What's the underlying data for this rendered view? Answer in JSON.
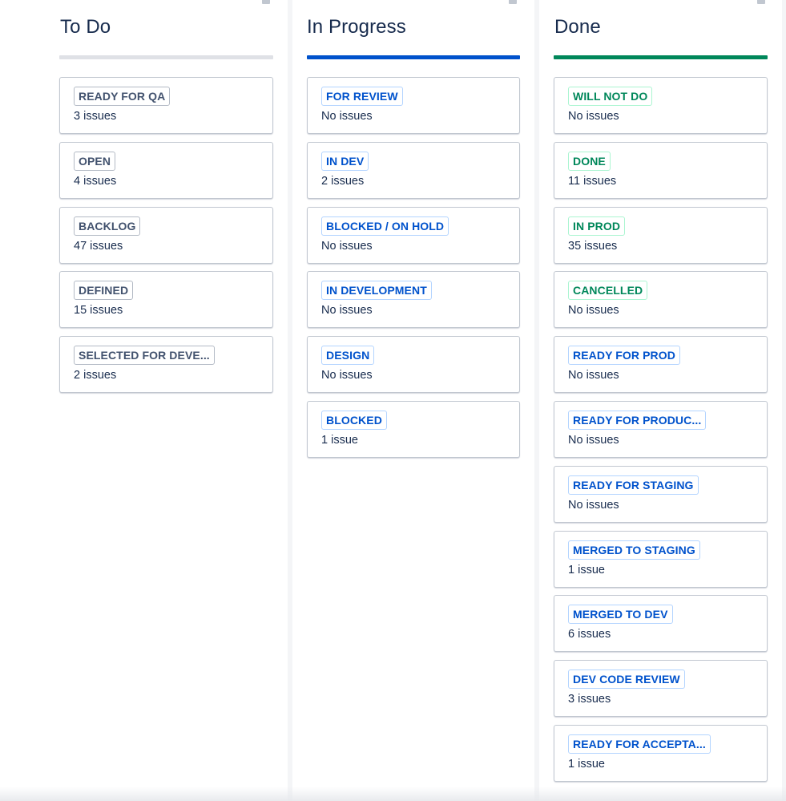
{
  "columns": {
    "todo": {
      "title": "To Do",
      "statuses": [
        {
          "name": "READY FOR QA",
          "count": "3 issues"
        },
        {
          "name": "OPEN",
          "count": "4 issues"
        },
        {
          "name": "BACKLOG",
          "count": "47 issues"
        },
        {
          "name": "DEFINED",
          "count": "15 issues"
        },
        {
          "name": "SELECTED FOR DEVE...",
          "count": "2 issues"
        }
      ]
    },
    "progress": {
      "title": "In Progress",
      "statuses": [
        {
          "name": "FOR REVIEW",
          "count": "No issues"
        },
        {
          "name": "IN DEV",
          "count": "2 issues"
        },
        {
          "name": "BLOCKED / ON HOLD",
          "count": "No issues"
        },
        {
          "name": "IN DEVELOPMENT",
          "count": "No issues"
        },
        {
          "name": "DESIGN",
          "count": "No issues"
        },
        {
          "name": "BLOCKED",
          "count": "1 issue"
        }
      ]
    },
    "done": {
      "title": "Done",
      "statuses": [
        {
          "name": "WILL NOT DO",
          "count": "No issues",
          "category": "done"
        },
        {
          "name": "DONE",
          "count": "11 issues",
          "category": "done"
        },
        {
          "name": "IN PROD",
          "count": "35 issues",
          "category": "done"
        },
        {
          "name": "CANCELLED",
          "count": "No issues",
          "category": "done"
        },
        {
          "name": "READY FOR PROD",
          "count": "No issues",
          "category": "progress"
        },
        {
          "name": "READY FOR PRODUC...",
          "count": "No issues",
          "category": "progress"
        },
        {
          "name": "READY FOR STAGING",
          "count": "No issues",
          "category": "progress"
        },
        {
          "name": "MERGED TO STAGING",
          "count": "1 issue",
          "category": "progress"
        },
        {
          "name": "MERGED TO DEV",
          "count": "6 issues",
          "category": "progress"
        },
        {
          "name": "DEV CODE REVIEW",
          "count": "3 issues",
          "category": "progress"
        },
        {
          "name": "READY FOR ACCEPTA...",
          "count": "1 issue",
          "category": "progress"
        }
      ]
    }
  },
  "colors": {
    "todo_bar": "#dfe1e6",
    "progress_bar": "#0052cc",
    "done_bar": "#00875a",
    "todo_lozenge": "#42526e",
    "progress_lozenge": "#0052cc",
    "done_lozenge": "#00875a"
  },
  "icons": {
    "column_action": "trash-icon"
  }
}
